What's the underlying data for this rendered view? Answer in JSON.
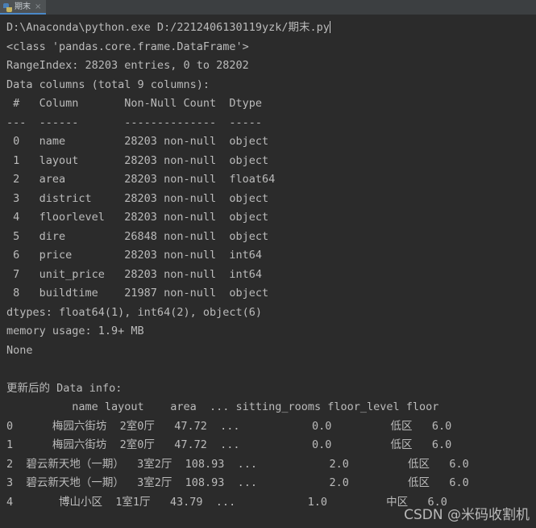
{
  "tabbar": {
    "tabs": [
      {
        "label": "期末",
        "icon": "python-file-icon",
        "close": "×",
        "active": true
      }
    ]
  },
  "console": {
    "colors": {
      "background": "#2b2b2b",
      "tabbar_background": "#3c3f41",
      "active_tab_background": "#4e5254",
      "active_tab_underline": "#4a88c7",
      "text": "#bbbbbb",
      "watermark": "#d9d9d9"
    },
    "command_line": "D:\\Anaconda\\python.exe D:/2212406130119yzk/期末.py",
    "info_block": {
      "class_line": "<class 'pandas.core.frame.DataFrame'>",
      "range_index": "RangeIndex: 28203 entries, 0 to 28202",
      "columns_total": "Data columns (total 9 columns):",
      "header": " #   Column       Non-Null Count  Dtype  ",
      "separator": "---  ------       --------------  -----  ",
      "rows": [
        " 0   name         28203 non-null  object ",
        " 1   layout       28203 non-null  object ",
        " 2   area         28203 non-null  float64",
        " 3   district     28203 non-null  object ",
        " 4   floorlevel   28203 non-null  object ",
        " 5   dire         26848 non-null  object ",
        " 6   price        28203 non-null  int64  ",
        " 7   unit_price   28203 non-null  int64  ",
        " 8   buildtime    21987 non-null  object "
      ],
      "dtypes": "dtypes: float64(1), int64(2), object(6)",
      "memory_usage": "memory usage: 1.9+ MB",
      "none": "None"
    },
    "updated_section": {
      "title": "更新后的 Data info:",
      "table_header": "          name layout    area  ... sitting_rooms floor_level floor",
      "table_rows": [
        "0      梅园六街坊  2室0厅   47.72  ...           0.0         低区   6.0",
        "1      梅园六街坊  2室0厅   47.72  ...           0.0         低区   6.0",
        "2  碧云新天地（一期）  3室2厅  108.93  ...           2.0         低区   6.0",
        "3  碧云新天地（一期）  3室2厅  108.93  ...           2.0         低区   6.0",
        "4       博山小区  1室1厅   43.79  ...           1.0         中区   6.0"
      ]
    }
  },
  "watermark": {
    "text": "CSDN @米码收割机"
  }
}
